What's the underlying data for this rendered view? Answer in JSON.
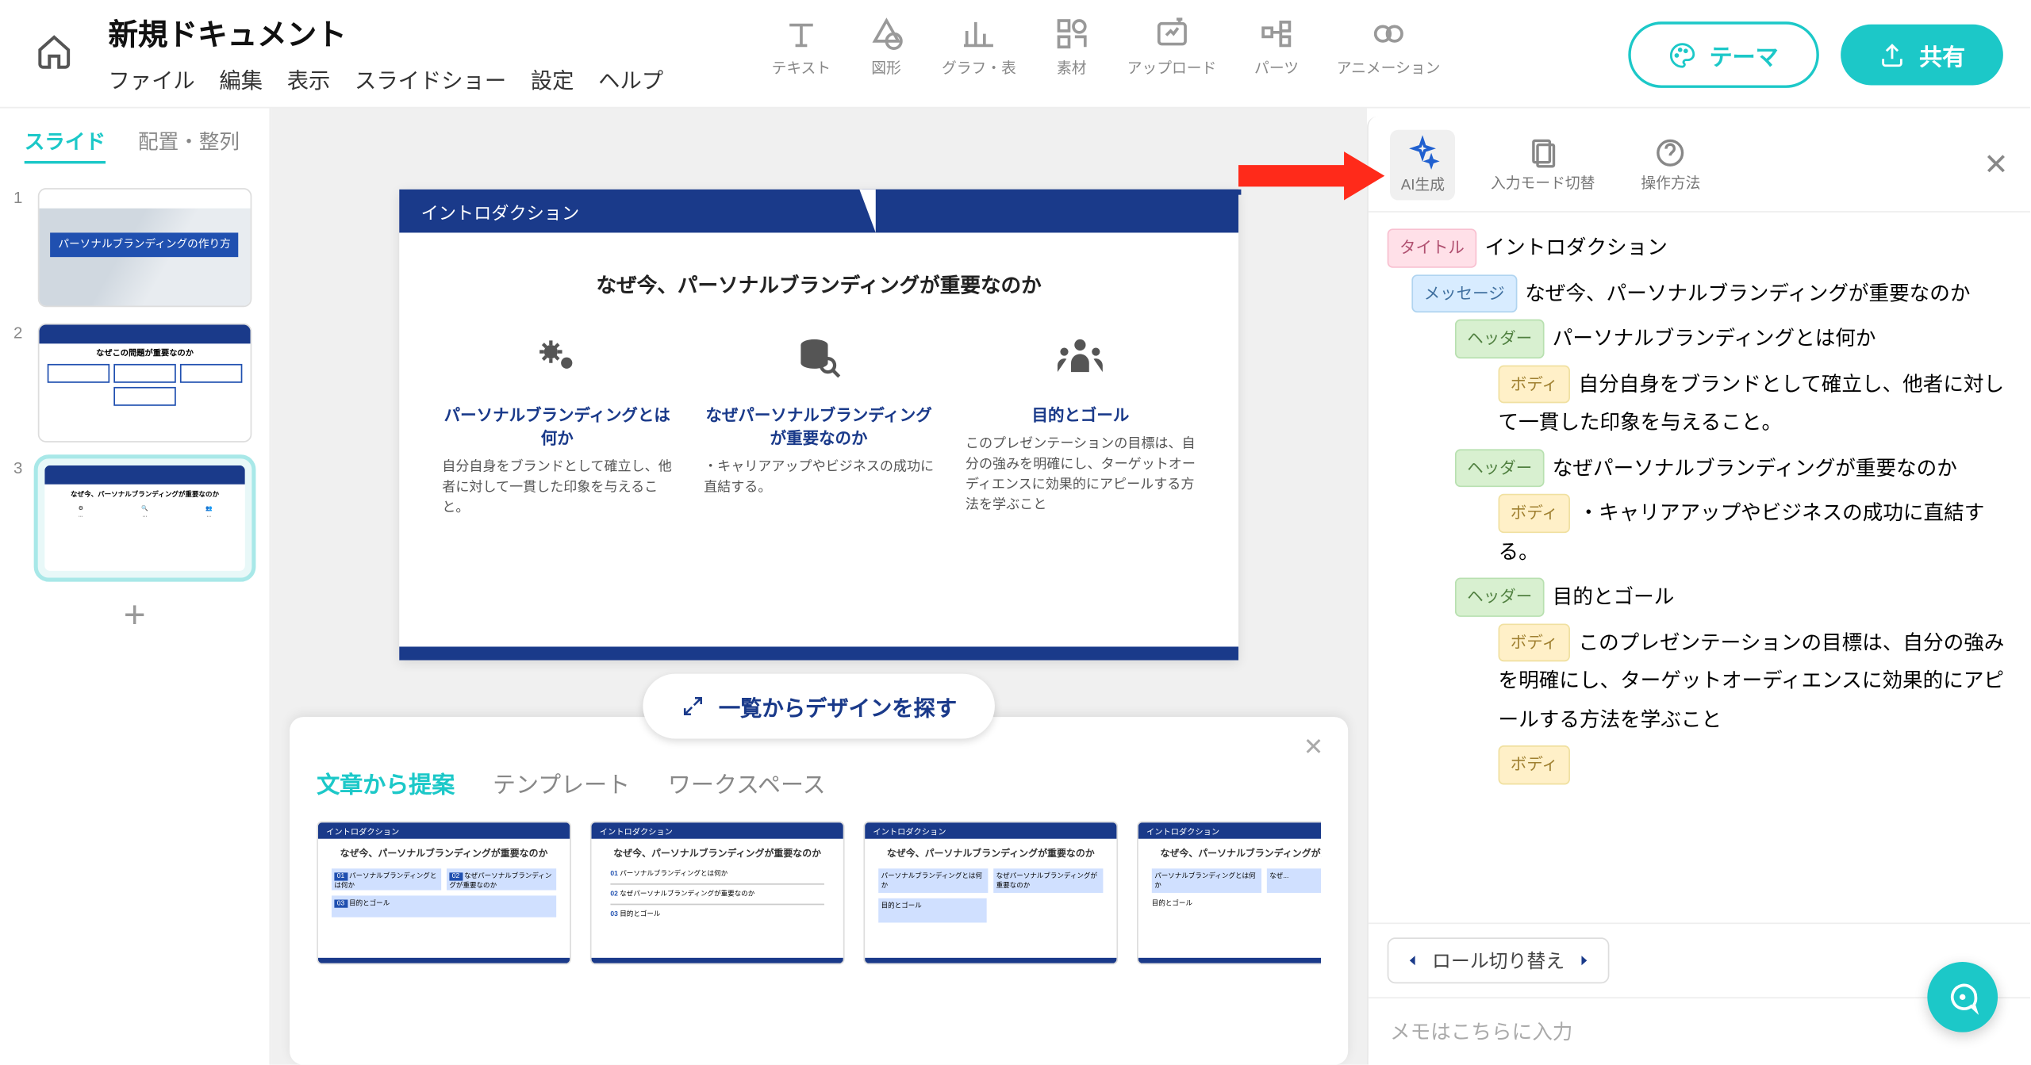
{
  "header": {
    "docTitle": "新規ドキュメント",
    "menus": {
      "file": "ファイル",
      "edit": "編集",
      "view": "表示",
      "slideshow": "スライドショー",
      "settings": "設定",
      "help": "ヘルプ"
    },
    "tools": {
      "text": "テキスト",
      "shape": "図形",
      "chart": "グラフ・表",
      "assets": "素材",
      "upload": "アップロード",
      "parts": "パーツ",
      "animation": "アニメーション"
    },
    "themeBtn": "テーマ",
    "shareBtn": "共有"
  },
  "leftSidebar": {
    "tabs": {
      "slides": "スライド",
      "arrange": "配置・整列"
    },
    "thumbs": [
      {
        "num": "1",
        "label": "パーソナルブランディングの作り方"
      },
      {
        "num": "2",
        "label": ""
      },
      {
        "num": "3",
        "label": ""
      }
    ],
    "addSlide": "+"
  },
  "slide": {
    "title": "イントロダクション",
    "subtitle": "なぜ今、パーソナルブランディングが重要なのか",
    "cols": [
      {
        "title": "パーソナルブランディングとは何か",
        "body": "自分自身をブランドとして確立し、他者に対して一貫した印象を与えること。"
      },
      {
        "title": "なぜパーソナルブランディングが重要なのか",
        "body": "・キャリアアップやビジネスの成功に直結する。"
      },
      {
        "title": "目的とゴール",
        "body": "このプレゼンテーションの目標は、自分の強みを明確にし、ターゲットオーディエンスに効果的にアピールする方法を学ぶこと"
      }
    ]
  },
  "designPanel": {
    "browseBtn": "一覧からデザインを探す",
    "tabs": {
      "suggest": "文章から提案",
      "template": "テンプレート",
      "workspace": "ワークスペース"
    },
    "miniTitle": "イントロダクション",
    "miniSub": "なぜ今、パーソナルブランディングが重要なのか"
  },
  "rightPanel": {
    "buttons": {
      "ai": "AI生成",
      "inputMode": "入力モード切替",
      "howto": "操作方法"
    },
    "tags": {
      "title": "タイトル",
      "message": "メッセージ",
      "header": "ヘッダー",
      "body": "ボディ"
    },
    "outline": {
      "title": "イントロダクション",
      "message": "なぜ今、パーソナルブランディングが重要なのか",
      "sections": [
        {
          "header": "パーソナルブランディングとは何か",
          "body": "自分自身をブランドとして確立し、他者に対して一貫した印象を与えること。"
        },
        {
          "header": "なぜパーソナルブランディングが重要なのか",
          "body": "・キャリアアップやビジネスの成功に直結する。"
        },
        {
          "header": "目的とゴール",
          "body": "このプレゼンテーションの目標は、自分の強みを明確にし、ターゲットオーディエンスに効果的にアピールする方法を学ぶこと"
        }
      ]
    },
    "roleSwitch": "ロール切り替え",
    "memoPlaceholder": "メモはこちらに入力"
  }
}
